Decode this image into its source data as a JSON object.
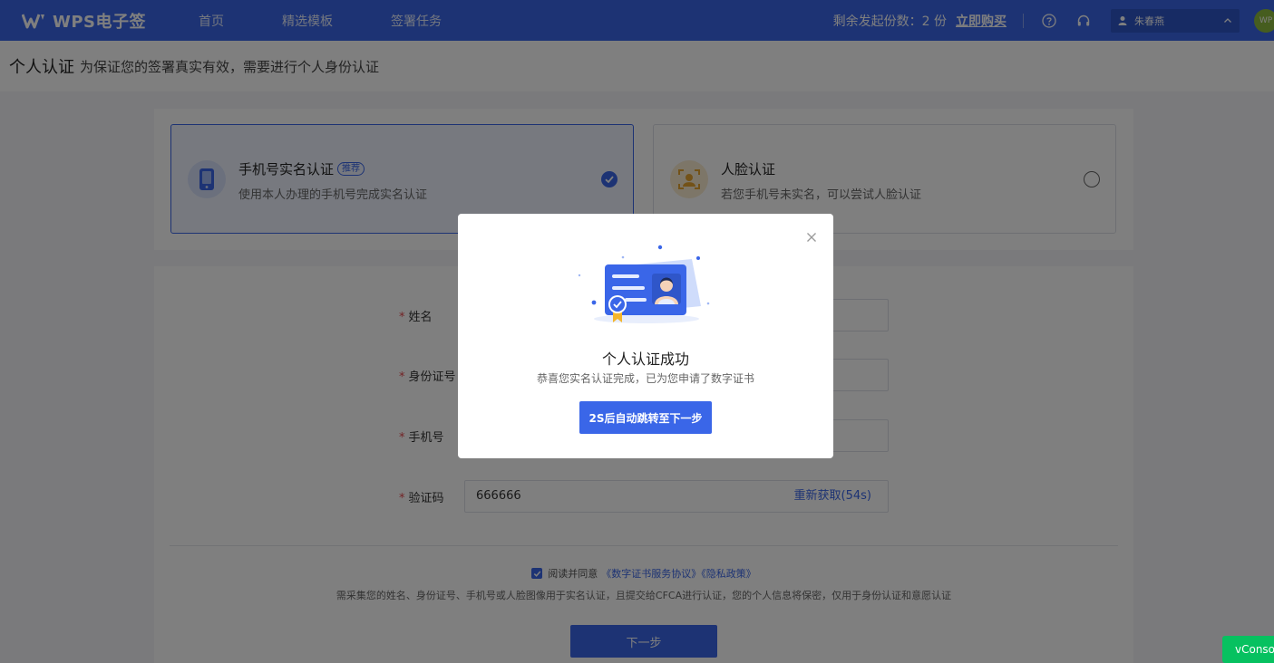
{
  "header": {
    "logo_text": "WPS电子签",
    "nav": [
      "首页",
      "精选模板",
      "签署任务"
    ],
    "remaining_label": "剩余发起份数：2 份",
    "buy_label": "立即购买",
    "user_name": "朱春燕",
    "avatar_text": "WP"
  },
  "titlebar": {
    "title": "个人认证",
    "subtitle": "为保证您的签署真实有效，需要进行个人身份认证"
  },
  "methods": [
    {
      "title": "手机号实名认证",
      "tag": "推荐",
      "desc": "使用本人办理的手机号完成实名认证",
      "selected": true
    },
    {
      "title": "人脸认证",
      "desc": "若您手机号未实名，可以尝试人脸认证",
      "selected": false
    }
  ],
  "form": {
    "fields": [
      {
        "label": "姓名",
        "value": ""
      },
      {
        "label": "身份证号",
        "value": ""
      },
      {
        "label": "手机号",
        "value": ""
      },
      {
        "label": "验证码",
        "value": "666666"
      }
    ],
    "resend_label": "重新获取(54s)",
    "agree_text": "阅读并同意",
    "agree_link": "《数字证书服务协议》《隐私政策》",
    "note": "需采集您的姓名、身份证号、手机号或人脸图像用于实名认证，且提交给CFCA进行认证，您的个人信息将保密，仅用于身份认证和意愿认证",
    "next_label": "下一步"
  },
  "modal": {
    "title": "个人认证成功",
    "desc": "恭喜您实名认证完成，已为您申请了数字证书",
    "button_label": "2S后自动跳转至下一步"
  },
  "vconsole_label": "vConsole",
  "colors": {
    "primary": "#3a66e8",
    "vconsole": "#07c160"
  }
}
